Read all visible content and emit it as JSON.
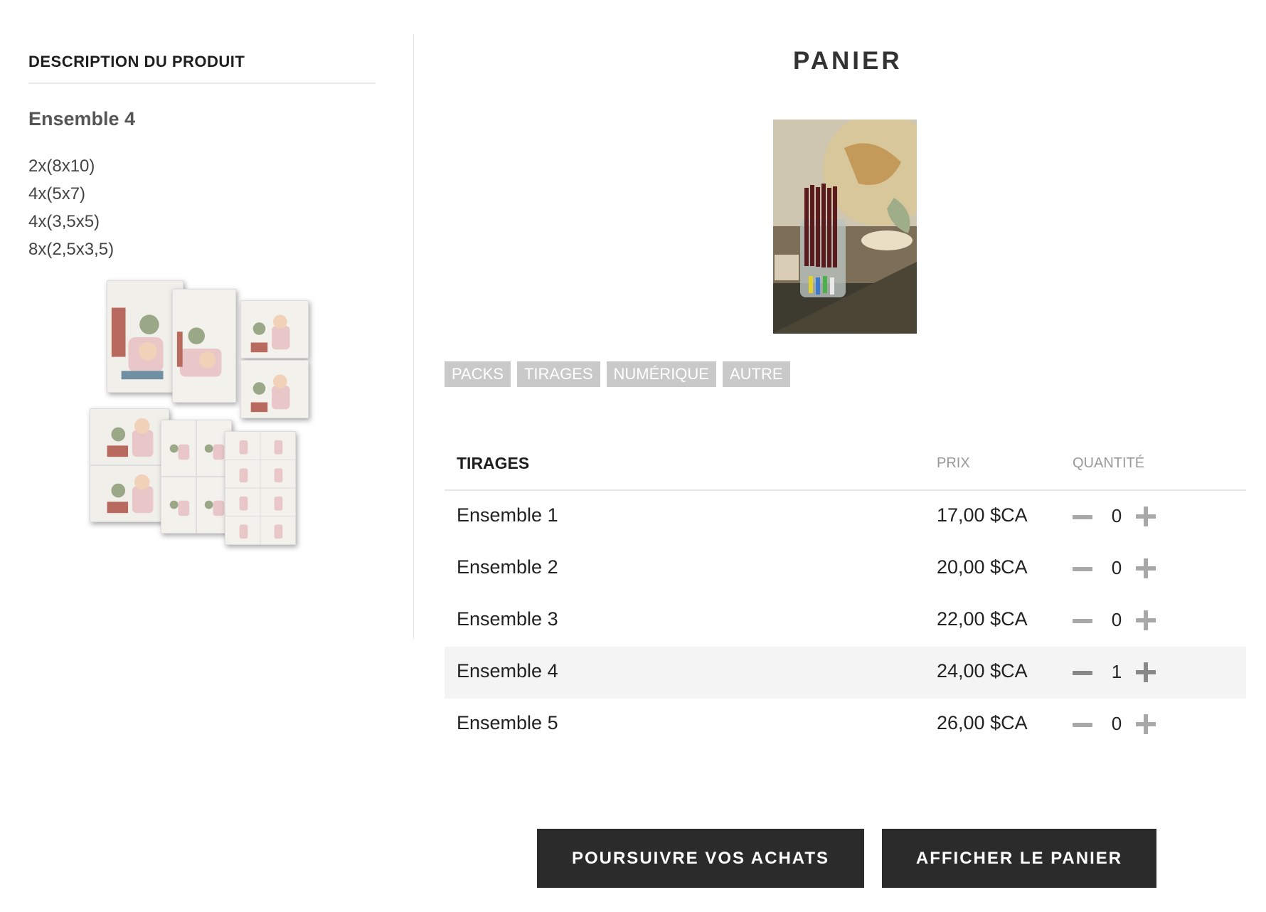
{
  "description": {
    "heading": "DESCRIPTION DU PRODUIT",
    "product_name": "Ensemble 4",
    "specs": [
      "2x(8x10)",
      "4x(5x7)",
      "4x(3,5x5)",
      "8x(2,5x3,5)"
    ]
  },
  "cart": {
    "title": "PANIER",
    "tabs": [
      "PACKS",
      "TIRAGES",
      "NUMÉRIQUE",
      "AUTRE"
    ],
    "table": {
      "col_name": "TIRAGES",
      "col_price": "PRIX",
      "col_qty": "QUANTITÉ",
      "rows": [
        {
          "name": "Ensemble 1",
          "price": "17,00 $CA",
          "qty": "0"
        },
        {
          "name": "Ensemble 2",
          "price": "20,00 $CA",
          "qty": "0"
        },
        {
          "name": "Ensemble 3",
          "price": "22,00 $CA",
          "qty": "0"
        },
        {
          "name": "Ensemble 4",
          "price": "24,00 $CA",
          "qty": "1"
        },
        {
          "name": "Ensemble 5",
          "price": "26,00 $CA",
          "qty": "0"
        }
      ],
      "selected_row": "Ensemble 4"
    },
    "buttons": {
      "continue": "POURSUIVRE VOS ACHATS",
      "view_cart": "AFFICHER LE PANIER"
    }
  },
  "colors": {
    "button_bg": "#2b2b2b",
    "tab_bg": "#c9c9c9",
    "selected_row_bg": "#f4f4f4"
  }
}
